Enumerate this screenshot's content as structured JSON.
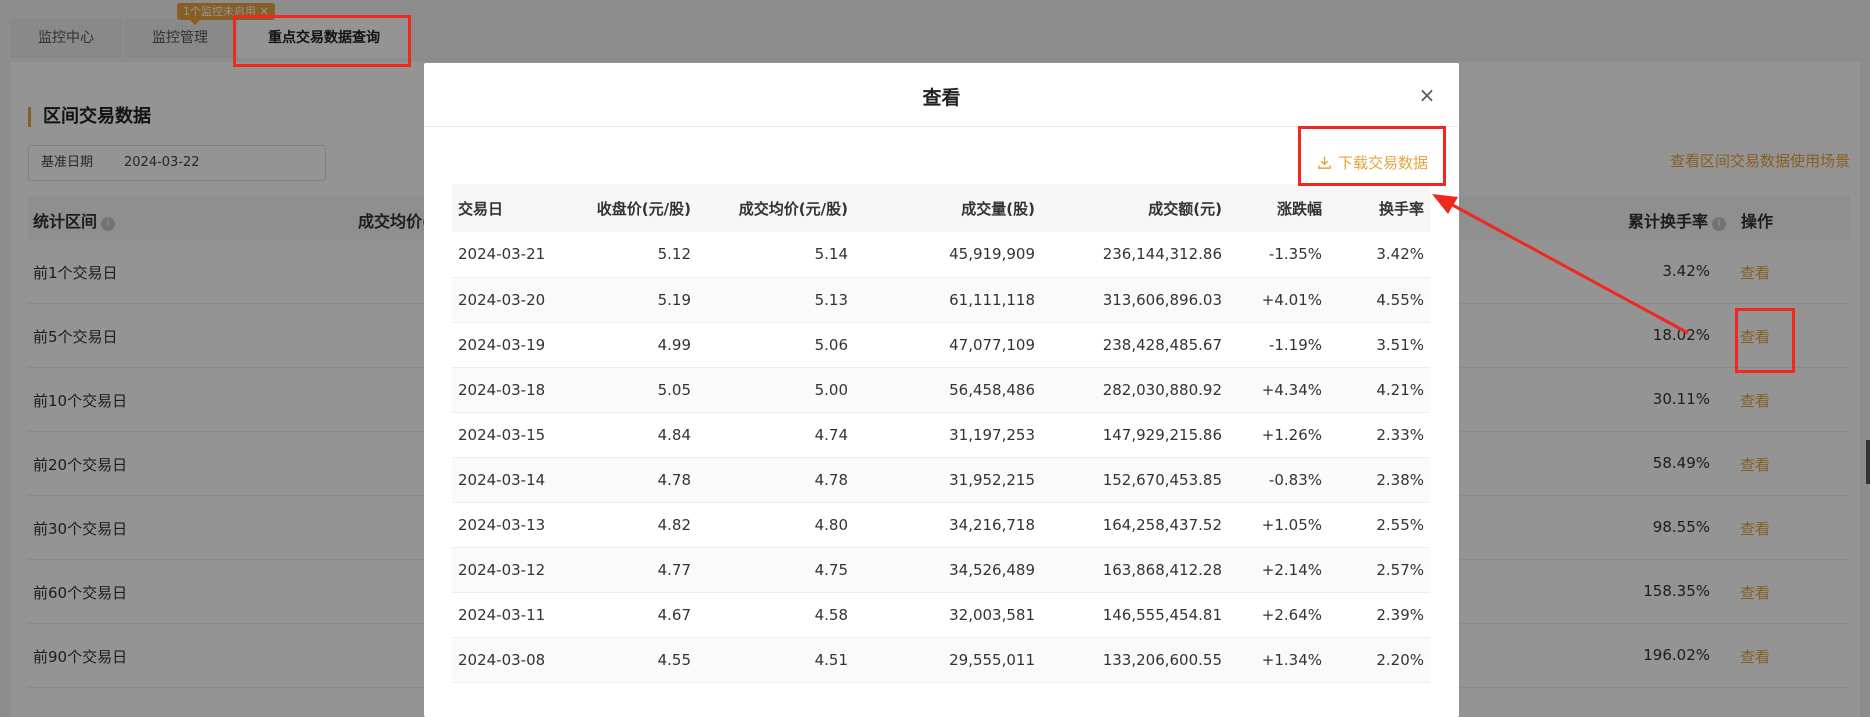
{
  "tabs": [
    {
      "label": "监控中心"
    },
    {
      "label": "监控管理"
    },
    {
      "label": "重点交易数据查询"
    }
  ],
  "badge": "1个监控未启用 ✕",
  "section": {
    "title": "区间交易数据",
    "date_label": "基准日期",
    "date_value": "2024-03-22",
    "usage_link": "查看区间交易数据使用场景"
  },
  "bg_table": {
    "headers": {
      "range": "统计区间",
      "avg": "成交均价(元",
      "turnover": "累计换手率",
      "action": "操作"
    },
    "rows": [
      {
        "name": "前1个交易日",
        "rate": "3.42%",
        "action": "查看"
      },
      {
        "name": "前5个交易日",
        "rate": "18.02%",
        "action": "查看"
      },
      {
        "name": "前10个交易日",
        "rate": "30.11%",
        "action": "查看"
      },
      {
        "name": "前20个交易日",
        "rate": "58.49%",
        "action": "查看"
      },
      {
        "name": "前30个交易日",
        "rate": "98.55%",
        "action": "查看"
      },
      {
        "name": "前60个交易日",
        "rate": "158.35%",
        "action": "查看"
      },
      {
        "name": "前90个交易日",
        "rate": "196.02%",
        "action": "查看"
      }
    ]
  },
  "modal": {
    "title": "查看",
    "close": "×",
    "download_label": "下载交易数据",
    "columns": [
      "交易日",
      "收盘价(元/股)",
      "成交均价(元/股)",
      "成交量(股)",
      "成交额(元)",
      "涨跌幅",
      "换手率"
    ],
    "rows": [
      [
        "2024-03-21",
        "5.12",
        "5.14",
        "45,919,909",
        "236,144,312.86",
        "-1.35%",
        "3.42%"
      ],
      [
        "2024-03-20",
        "5.19",
        "5.13",
        "61,111,118",
        "313,606,896.03",
        "+4.01%",
        "4.55%"
      ],
      [
        "2024-03-19",
        "4.99",
        "5.06",
        "47,077,109",
        "238,428,485.67",
        "-1.19%",
        "3.51%"
      ],
      [
        "2024-03-18",
        "5.05",
        "5.00",
        "56,458,486",
        "282,030,880.92",
        "+4.34%",
        "4.21%"
      ],
      [
        "2024-03-15",
        "4.84",
        "4.74",
        "31,197,253",
        "147,929,215.86",
        "+1.26%",
        "2.33%"
      ],
      [
        "2024-03-14",
        "4.78",
        "4.78",
        "31,952,215",
        "152,670,453.85",
        "-0.83%",
        "2.38%"
      ],
      [
        "2024-03-13",
        "4.82",
        "4.80",
        "34,216,718",
        "164,258,437.52",
        "+1.05%",
        "2.55%"
      ],
      [
        "2024-03-12",
        "4.77",
        "4.75",
        "34,526,489",
        "163,868,412.28",
        "+2.14%",
        "2.57%"
      ],
      [
        "2024-03-11",
        "4.67",
        "4.58",
        "32,003,581",
        "146,555,454.81",
        "+2.64%",
        "2.39%"
      ],
      [
        "2024-03-08",
        "4.55",
        "4.51",
        "29,555,011",
        "133,206,600.55",
        "+1.34%",
        "2.20%"
      ]
    ]
  },
  "colors": {
    "accent": "#e8a23e",
    "positive": "#e94444",
    "negative": "#1aab1a",
    "annotation": "#f0281e"
  }
}
